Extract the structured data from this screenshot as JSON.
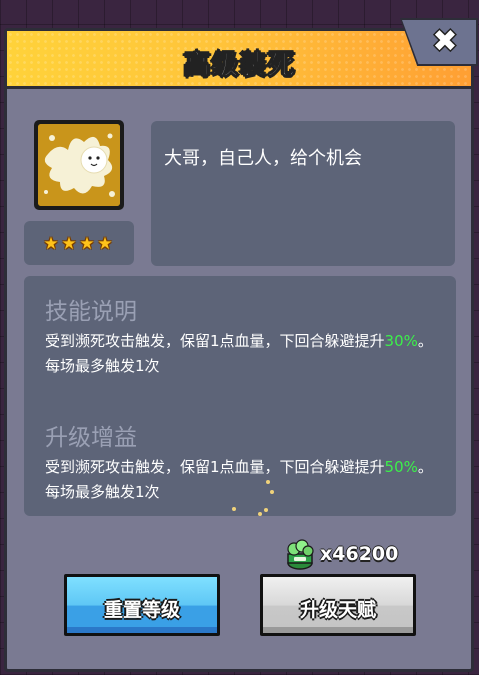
{
  "dialog": {
    "title": "高级装死",
    "close_icon": "close-x-icon"
  },
  "skill": {
    "icon": "splat-character-icon",
    "stars": [
      "★",
      "★",
      "★",
      "★"
    ],
    "star_count": 4,
    "quote": "大哥，自己人，给个机会"
  },
  "description": {
    "title": "技能说明",
    "text_before": "受到濒死攻击触发，保留1点血量，下回合躲避提升",
    "value": "30%",
    "text_after": "。每场最多触发1次"
  },
  "upgrade": {
    "title": "升级增益",
    "text_before": "受到濒死攻击触发，保留1点血量，下回合躲避提升",
    "value": "50%",
    "text_after": "。每场最多触发1次"
  },
  "cost": {
    "icon": "green-currency-jar-icon",
    "amount": "x46200"
  },
  "buttons": {
    "reset_label": "重置等级",
    "upgrade_label": "升级天赋"
  },
  "colors": {
    "header": "#ffc43a",
    "panel": "#7a7a92",
    "highlight": "#3cf04a",
    "reset_button": "#5fc7f5",
    "upgrade_button": "#d8d8d8"
  }
}
